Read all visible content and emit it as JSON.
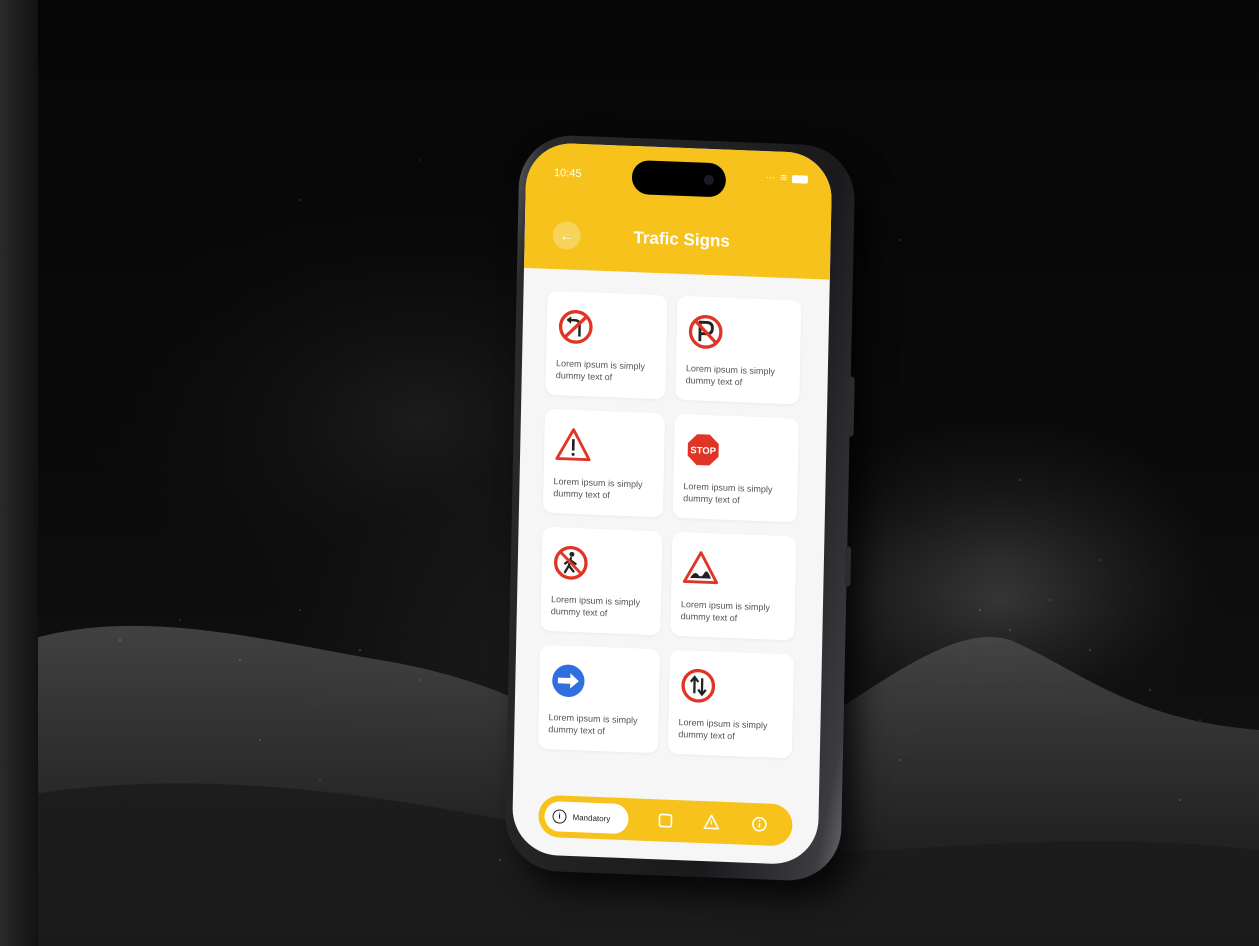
{
  "status_bar": {
    "time": "10:45"
  },
  "header": {
    "back_icon": "arrow-left-icon",
    "title": "Trafic Signs"
  },
  "colors": {
    "accent": "#f6c21b",
    "sign_red": "#e03526",
    "sign_blue": "#2f6fe0",
    "card_text": "#555555"
  },
  "cards": [
    {
      "icon": "no-left-turn-icon",
      "text": "Lorem ipsum is simply dummy text of"
    },
    {
      "icon": "no-parking-icon",
      "text": "Lorem ipsum is simply dummy text of"
    },
    {
      "icon": "warning-triangle-icon",
      "text": "Lorem ipsum is simply dummy text of"
    },
    {
      "icon": "stop-sign-icon",
      "text": "Lorem ipsum is simply dummy text of",
      "sign_text": "STOP"
    },
    {
      "icon": "no-pedestrians-icon",
      "text": "Lorem ipsum is simply dummy text of"
    },
    {
      "icon": "uneven-road-icon",
      "text": "Lorem ipsum is simply dummy text of"
    },
    {
      "icon": "keep-right-icon",
      "text": "Lorem ipsum is simply dummy text of"
    },
    {
      "icon": "two-way-traffic-icon",
      "text": "Lorem ipsum is simply dummy text of"
    }
  ],
  "bottom_nav": {
    "active": {
      "icon": "info-circle-icon",
      "label": "Mandatory"
    },
    "items": [
      {
        "icon": "square-icon"
      },
      {
        "icon": "warning-icon"
      },
      {
        "icon": "info-icon"
      }
    ]
  }
}
